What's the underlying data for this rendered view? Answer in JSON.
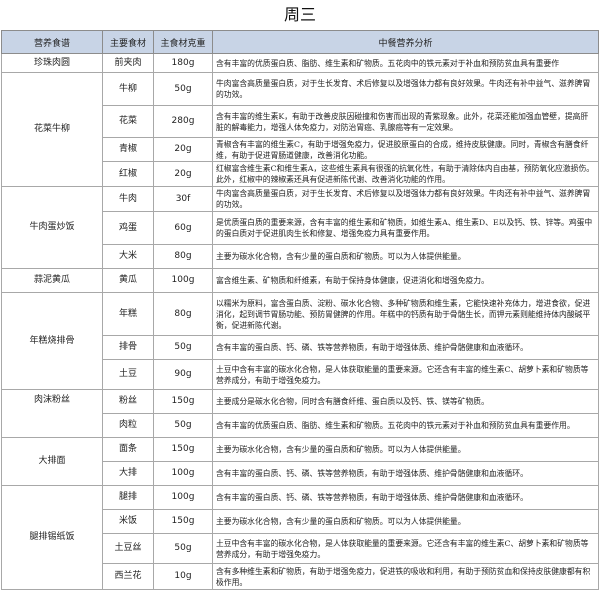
{
  "title": "周三",
  "headers": [
    "营养食谱",
    "主要食材",
    "主食材克重",
    "中餐营养分析"
  ],
  "dishes": [
    {
      "name": "珍珠肉圆",
      "items": [
        {
          "ingredient": "前夹肉",
          "weight": "180g",
          "analysis": "含有丰富的优质蛋白质、脂肪、维生素和矿物质。五花肉中的铁元素对于补血和预防贫血具有重要作"
        }
      ]
    },
    {
      "name": "花菜牛柳",
      "items": [
        {
          "ingredient": "牛柳",
          "weight": "50g",
          "analysis": "牛肉富含高质量蛋白质，对于生长发育、术后修复以及增强体力都有良好效果。牛肉还有补中益气、滋养脾胃的功效。"
        },
        {
          "ingredient": "花菜",
          "weight": "280g",
          "analysis": "含有丰富的维生素K，有助于改善皮肤因碰撞和伤害而出现的青紫现象。此外，花菜还能加强血管壁，提高肝脏的解毒能力，增强人体免疫力，对防治胃癌、乳腺癌等有一定效果。"
        },
        {
          "ingredient": "青椒",
          "weight": "20g",
          "analysis": "青椒含有丰富的维生素C，有助于增强免疫力，促进胶原蛋白的合成，维持皮肤健康。同时，青椒含有膳食纤维，有助于促进胃肠道健康，改善消化功能。"
        },
        {
          "ingredient": "红椒",
          "weight": "20g",
          "analysis": "红椒富含维生素C和维生素A，这些维生素具有很强的抗氧化性，有助于清除体内自由基，预防氧化应激损伤。此外，红椒中的辣椒素还具有促进新陈代谢、改善消化功能的作用。"
        }
      ]
    },
    {
      "name": "牛肉蛋炒饭",
      "items": [
        {
          "ingredient": "牛肉",
          "weight": "30f",
          "analysis": "牛肉富含高质量蛋白质，对于生长发育、术后修复以及增强体力都有良好效果。牛肉还有补中益气、滋养脾胃的功效。"
        },
        {
          "ingredient": "鸡蛋",
          "weight": "60g",
          "analysis": "是优质蛋白质的重要来源，含有丰富的维生素和矿物质，如维生素A、维生素D、E以及钙、铁、锌等。鸡蛋中的蛋白质对于促进肌肉生长和修复、增强免疫力具有重要作用。"
        },
        {
          "ingredient": "大米",
          "weight": "80g",
          "analysis": "主要为碳水化合物，含有少量的蛋白质和矿物质。可以为人体提供能量。"
        }
      ]
    },
    {
      "name": "蒜泥黄瓜",
      "items": [
        {
          "ingredient": "黄瓜",
          "weight": "100g",
          "analysis": "富含维生素、矿物质和纤维素，有助于保持身体健康，促进消化和增强免疫力。"
        }
      ]
    },
    {
      "name": "年糕烧排骨",
      "items": [
        {
          "ingredient": "年糕",
          "weight": "80g",
          "analysis": "以糯米为原料，富含蛋白质、淀粉、碳水化合物、多种矿物质和维生素，它能快速补充体力，增进食欲，促进消化，起到调节胃肠功能、预防胃健脾的作用。年糕中的钙质有助于骨骼生长，而钾元素则能维持体内酸碱平衡，促进新陈代谢。"
        },
        {
          "ingredient": "排骨",
          "weight": "50g",
          "analysis": "含有丰富的蛋白质、钙、磷、铁等营养物质，有助于增强体质、维护骨骼健康和血液循环。"
        },
        {
          "ingredient": "土豆",
          "weight": "90g",
          "analysis": "土豆中含有丰富的碳水化合物，是人体获取能量的重要来源。它还含有丰富的维生素C、胡萝卜素和矿物质等营养成分，有助于增强免疫力。"
        }
      ]
    },
    {
      "name": "肉沫粉丝",
      "items": [
        {
          "ingredient": "粉丝",
          "weight": "150g",
          "analysis": "主要成分是碳水化合物，同时含有膳食纤维、蛋白质以及钙、铁、镁等矿物质。"
        },
        {
          "ingredient": "肉粒",
          "weight": "50g",
          "analysis": "含有丰富的优质蛋白质、脂肪、维生素和矿物质。五花肉中的铁元素对于补血和预防贫血具有重要作用。"
        }
      ]
    },
    {
      "name": "大排面",
      "items": [
        {
          "ingredient": "面条",
          "weight": "150g",
          "analysis": "主要为碳水化合物，含有少量的蛋白质和矿物质。可以为人体提供能量。"
        },
        {
          "ingredient": "大排",
          "weight": "100g",
          "analysis": "含有丰富的蛋白质、钙、磷、铁等营养物质，有助于增强体质、维护骨骼健康和血液循环。"
        }
      ]
    },
    {
      "name": "腿排锡纸饭",
      "items": [
        {
          "ingredient": "腿排",
          "weight": "100g",
          "analysis": "含有丰富的蛋白质、钙、磷、铁等营养物质，有助于增强体质、维护骨骼健康和血液循环。"
        },
        {
          "ingredient": "米饭",
          "weight": "150g",
          "analysis": "主要为碳水化合物，含有少量的蛋白质和矿物质。可以为人体提供能量。"
        },
        {
          "ingredient": "土豆丝",
          "weight": "50g",
          "analysis": "土豆中含有丰富的碳水化合物，是人体获取能量的重要来源。它还含有丰富的维生素C、胡萝卜素和矿物质等营养成分，有助于增强免疫力。"
        },
        {
          "ingredient": "西兰花",
          "weight": "10g",
          "analysis": "含有多种维生素和矿物质，有助于增强免疫力，促进铁的吸收和利用，有助于预防贫血和保持皮肤健康都有积极作用。"
        }
      ]
    }
  ]
}
